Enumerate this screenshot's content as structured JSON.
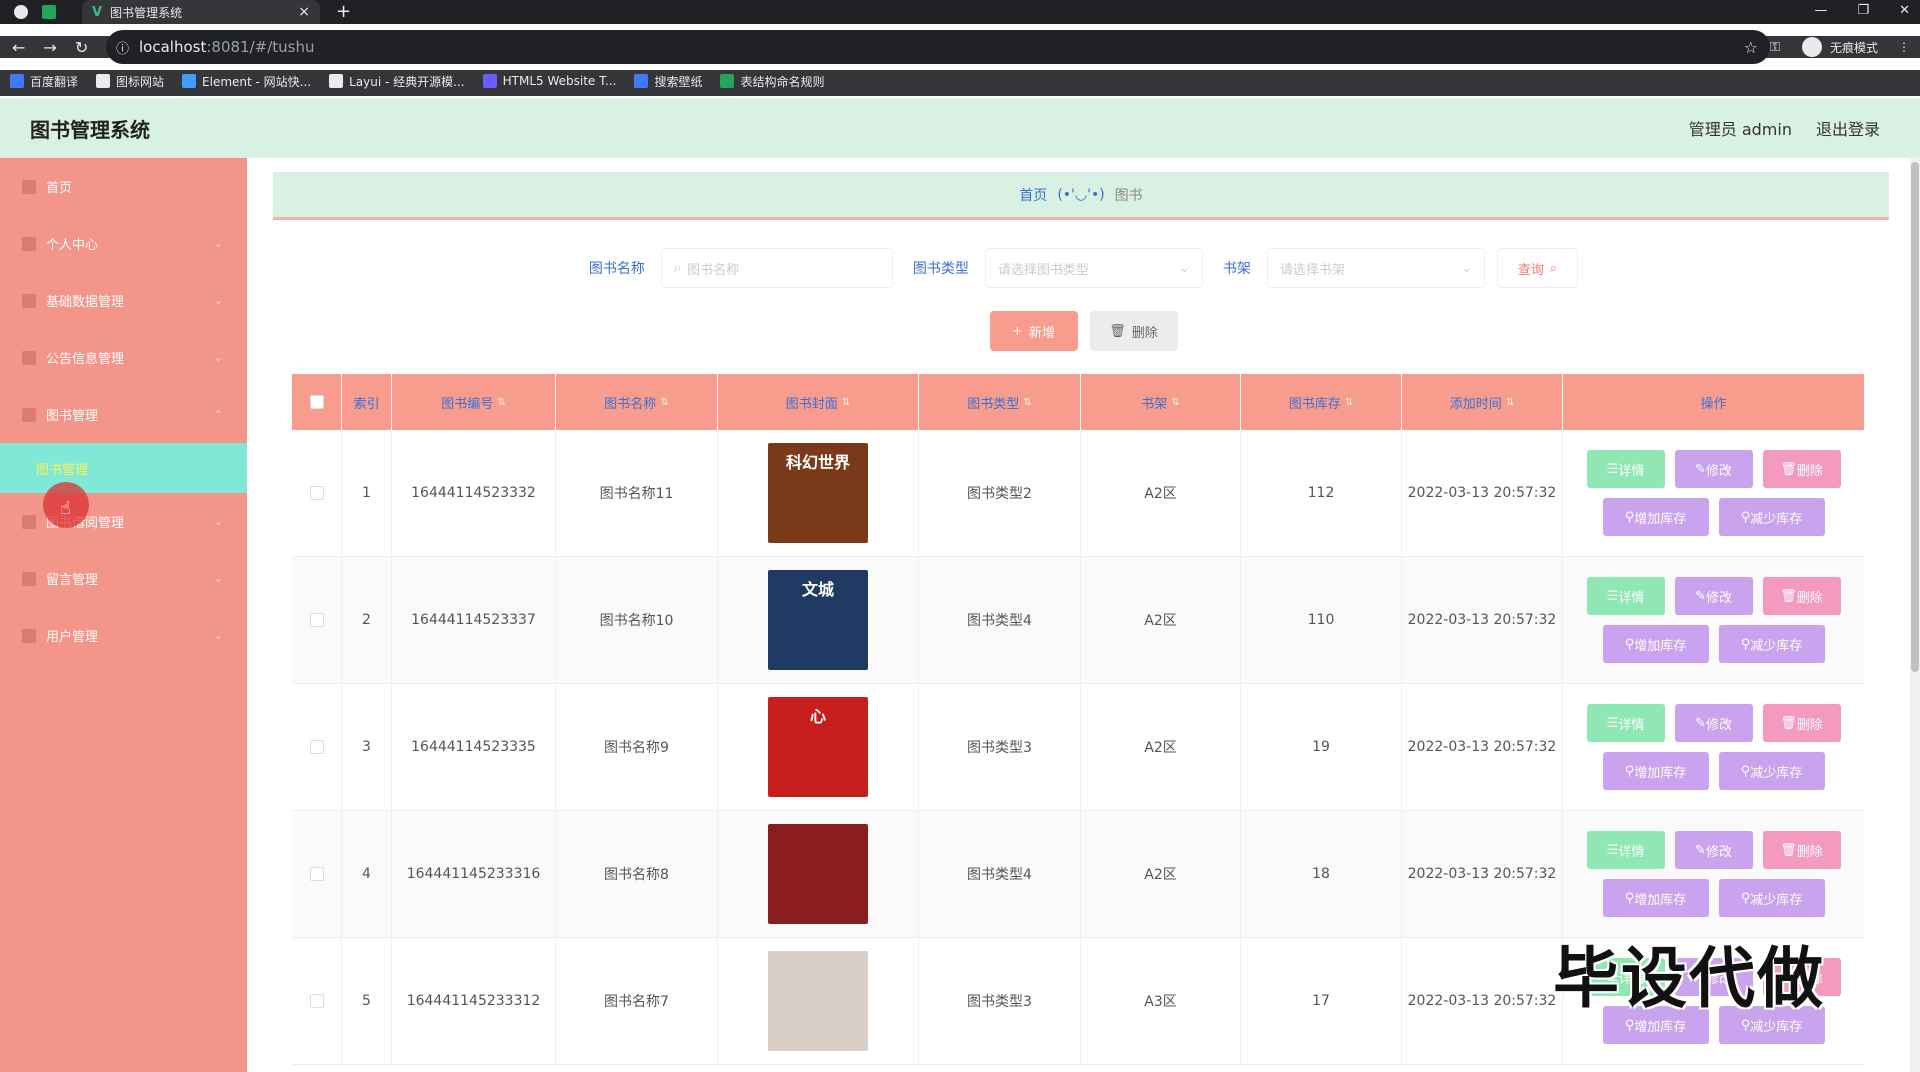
{
  "browser": {
    "tab_title": "图书管理系统",
    "url_host": "localhost",
    "url_path": ":8081/#/tushu",
    "incognito_label": "无痕模式",
    "bookmarks": [
      {
        "label": "百度翻译",
        "color": "#3a7bff"
      },
      {
        "label": "图标网站",
        "color": "#e8eaed"
      },
      {
        "label": "Element - 网站快...",
        "color": "#409eff"
      },
      {
        "label": "Layui - 经典开源模...",
        "color": "#e8eaed"
      },
      {
        "label": "HTML5 Website T...",
        "color": "#6a5cff"
      },
      {
        "label": "搜索壁纸",
        "color": "#3a7bff"
      },
      {
        "label": "表结构命名规则",
        "color": "#23a55a"
      }
    ]
  },
  "header": {
    "title": "图书管理系统",
    "user": "管理员 admin",
    "logout": "退出登录"
  },
  "sidebar": {
    "items": [
      {
        "label": "首页",
        "arrow": ""
      },
      {
        "label": "个人中心",
        "arrow": "⌄"
      },
      {
        "label": "基础数据管理",
        "arrow": "⌄"
      },
      {
        "label": "公告信息管理",
        "arrow": "⌄"
      },
      {
        "label": "图书管理",
        "arrow": "⌃"
      }
    ],
    "active_sub": "图书管理",
    "items_after": [
      {
        "label": "图书借阅管理",
        "arrow": "⌄"
      },
      {
        "label": "留言管理",
        "arrow": "⌄"
      },
      {
        "label": "用户管理",
        "arrow": "⌄"
      }
    ]
  },
  "breadcrumb": {
    "home": "首页",
    "sep": "(•'◡'•)",
    "current": "图书"
  },
  "search": {
    "name_label": "图书名称",
    "name_placeholder": "图书名称",
    "type_label": "图书类型",
    "type_placeholder": "请选择图书类型",
    "shelf_label": "书架",
    "shelf_placeholder": "请选择书架",
    "query_button": "查询"
  },
  "actions": {
    "add": "新增",
    "delete": "删除"
  },
  "table": {
    "headers": [
      "索引",
      "图书编号",
      "图书名称",
      "图书封面",
      "图书类型",
      "书架",
      "图书库存",
      "添加时间",
      "操作"
    ],
    "rows": [
      {
        "index": "1",
        "code": "16444114523332",
        "name": "图书名称11",
        "type": "图书类型2",
        "shelf": "A2区",
        "stock": "112",
        "time": "2022-03-13 20:57:32",
        "cover_color": "#7a3a1a",
        "cover_text": "科幻世界"
      },
      {
        "index": "2",
        "code": "16444114523337",
        "name": "图书名称10",
        "type": "图书类型4",
        "shelf": "A2区",
        "stock": "110",
        "time": "2022-03-13 20:57:32",
        "cover_color": "#1f3b63",
        "cover_text": "文城"
      },
      {
        "index": "3",
        "code": "16444114523335",
        "name": "图书名称9",
        "type": "图书类型3",
        "shelf": "A2区",
        "stock": "19",
        "time": "2022-03-13 20:57:32",
        "cover_color": "#c81e1e",
        "cover_text": "心"
      },
      {
        "index": "4",
        "code": "164441145233316",
        "name": "图书名称8",
        "type": "图书类型4",
        "shelf": "A2区",
        "stock": "18",
        "time": "2022-03-13 20:57:32",
        "cover_color": "#8a1d1d",
        "cover_text": ""
      },
      {
        "index": "5",
        "code": "164441145233312",
        "name": "图书名称7",
        "type": "图书类型3",
        "shelf": "A3区",
        "stock": "17",
        "time": "2022-03-13 20:57:32",
        "cover_color": "#d9cfc6",
        "cover_text": ""
      }
    ],
    "op_labels": {
      "detail": "详情",
      "edit": "修改",
      "delete": "删除",
      "inc": "增加库存",
      "dec": "减少库存"
    }
  },
  "watermark": "毕设代做"
}
